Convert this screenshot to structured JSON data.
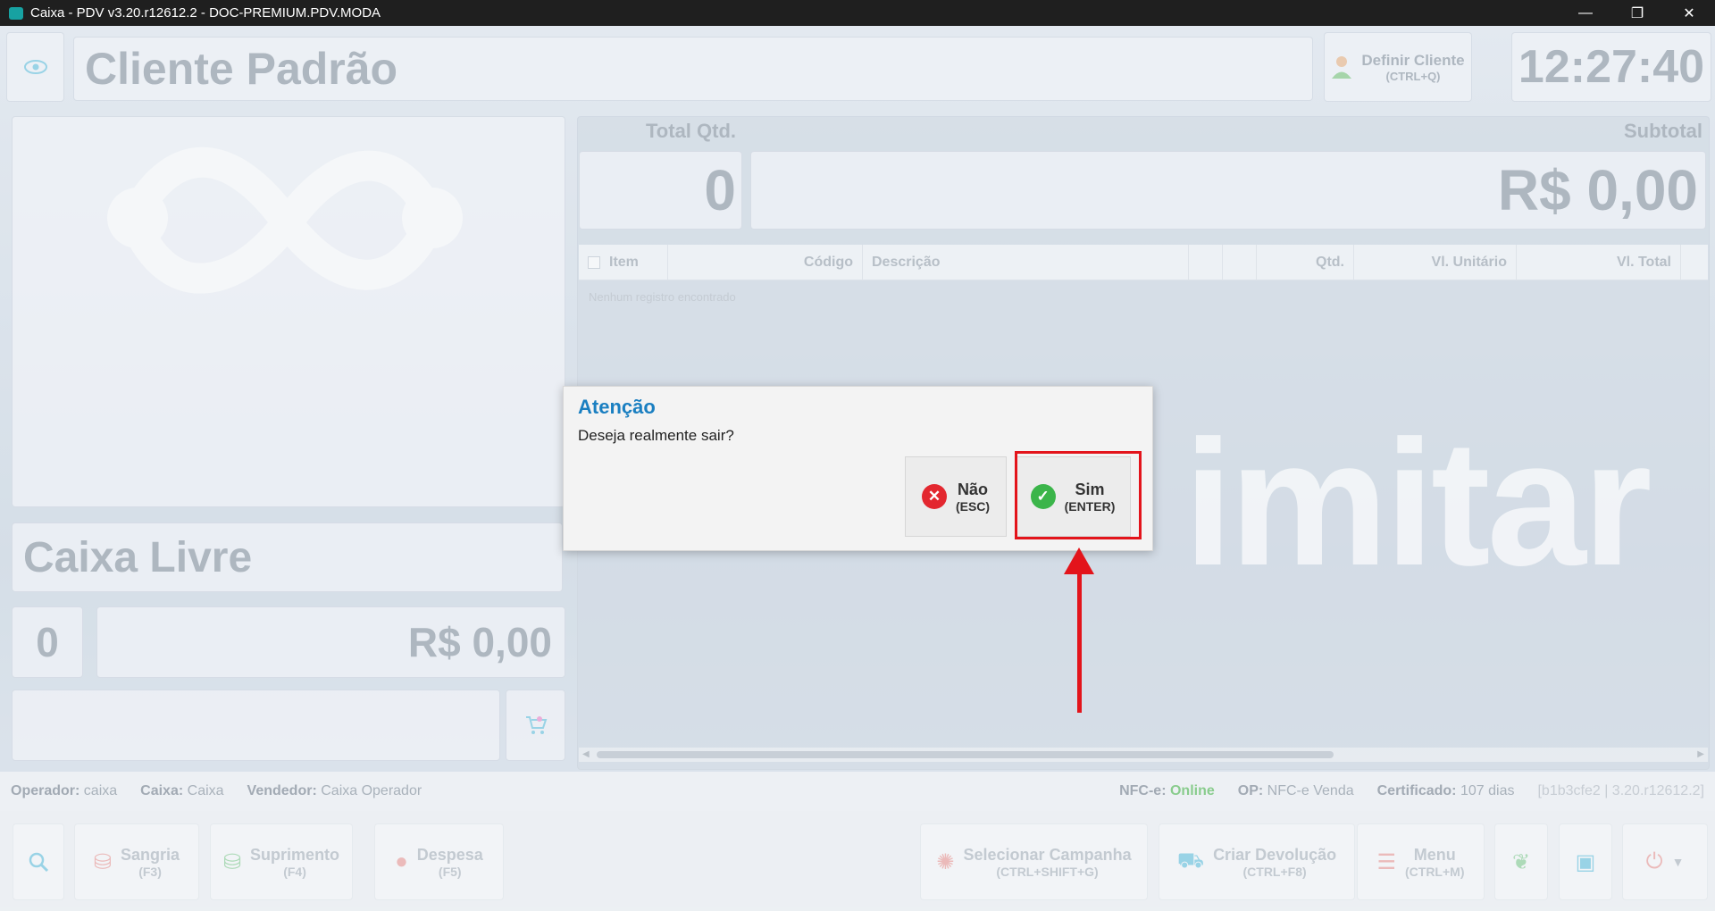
{
  "window": {
    "title": "Caixa - PDV v3.20.r12612.2 - DOC-PREMIUM.PDV.MODA",
    "minimize": "—",
    "maximize": "❐",
    "close": "✕"
  },
  "header": {
    "client_name": "Cliente Padrão",
    "define_client_label": "Definir Cliente",
    "define_client_shortcut": "(CTRL+Q)",
    "clock": "12:27:40"
  },
  "left": {
    "status": "Caixa Livre",
    "count": "0",
    "amount": "R$ 0,00"
  },
  "totals": {
    "total_qtd_label": "Total Qtd.",
    "total_qtd": "0",
    "subtotal_label": "Subtotal",
    "subtotal": "R$ 0,00"
  },
  "table": {
    "columns": [
      "Item",
      "Código",
      "Descrição",
      "",
      "",
      "Qtd.",
      "Vl. Unitário",
      "Vl. Total"
    ],
    "empty_message": "Nenhum registro encontrado"
  },
  "background_logo": "imitar",
  "statusbar": {
    "operator_label": "Operador:",
    "operator": "caixa",
    "caixa_label": "Caixa:",
    "caixa": "Caixa",
    "seller_label": "Vendedor:",
    "seller": "Caixa Operador",
    "nfce_label": "NFC-e:",
    "nfce": "Online",
    "op_label": "OP:",
    "op": "NFC-e Venda",
    "cert_label": "Certificado:",
    "cert": "107 dias",
    "version": "[b1b3cfe2 | 3.20.r12612.2]"
  },
  "toolbar": {
    "sangria": "Sangria",
    "sangria_key": "(F3)",
    "suprimento": "Suprimento",
    "suprimento_key": "(F4)",
    "despesa": "Despesa",
    "despesa_key": "(F5)",
    "campanha": "Selecionar Campanha",
    "campanha_key": "(CTRL+SHIFT+G)",
    "devolucao": "Criar Devolução",
    "devolucao_key": "(CTRL+F8)",
    "menu": "Menu",
    "menu_key": "(CTRL+M)"
  },
  "dialog": {
    "title": "Atenção",
    "message": "Deseja realmente sair?",
    "no_label": "Não",
    "no_key": "(ESC)",
    "yes_label": "Sim",
    "yes_key": "(ENTER)"
  },
  "colors": {
    "accent": "#1a7fc1",
    "annotation": "#e3141b",
    "online": "#7ccb7c"
  }
}
